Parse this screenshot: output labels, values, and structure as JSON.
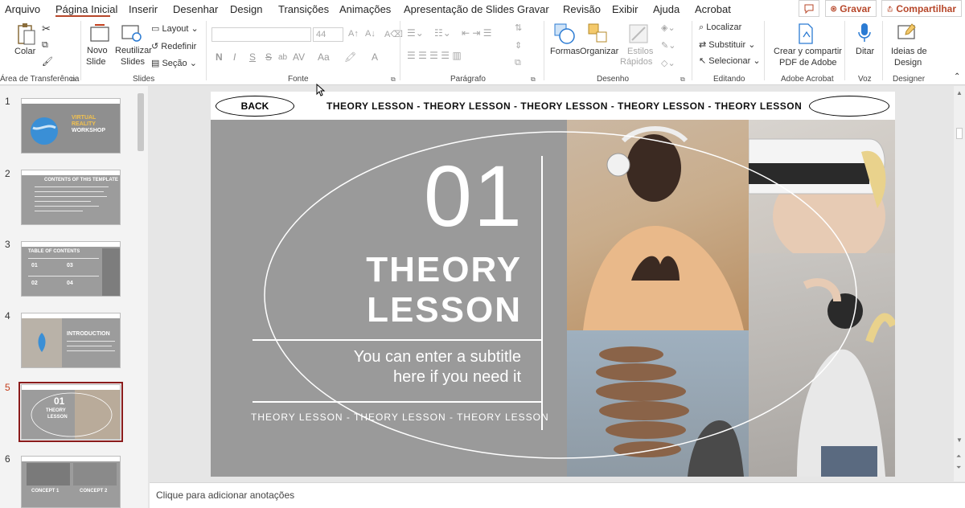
{
  "menu": {
    "tabs": [
      "Arquivo",
      "Página Inicial",
      "Inserir",
      "Desenhar",
      "Design",
      "Transições",
      "Animações",
      "Apresentação de Slides",
      "Gravar",
      "Revisão",
      "Exibir",
      "Ajuda",
      "Acrobat"
    ],
    "active_tab": "Página Inicial",
    "record_label": "Gravar",
    "share_label": "Compartilhar"
  },
  "ribbon": {
    "clipboard": {
      "paste": "Colar",
      "group": "Área de Transferência"
    },
    "slides": {
      "new_slide_1": "Novo",
      "new_slide_2": "Slide",
      "reuse_1": "Reutilizar",
      "reuse_2": "Slides",
      "layout": "Layout",
      "reset": "Redefinir",
      "section": "Seção",
      "group": "Slides"
    },
    "font": {
      "name_value": "",
      "size_value": "44",
      "bold": "N",
      "italic": "I",
      "underline": "S",
      "strike": "S",
      "spacing": "AV",
      "case": "Aa",
      "group": "Fonte"
    },
    "paragraph": {
      "group": "Parágrafo"
    },
    "drawing": {
      "shapes": "Formas",
      "arrange": "Organizar",
      "styles_1": "Estilos",
      "styles_2": "Rápidos",
      "group": "Desenho"
    },
    "editing": {
      "find": "Localizar",
      "replace": "Substituir",
      "select": "Selecionar",
      "group": "Editando"
    },
    "acrobat": {
      "create_1": "Crear y compartir",
      "create_2": "PDF de Adobe",
      "group": "Adobe Acrobat"
    },
    "voice": {
      "dictate": "Ditar",
      "group": "Voz"
    },
    "designer": {
      "ideas_1": "Ideias de",
      "ideas_2": "Design",
      "group": "Designer"
    }
  },
  "thumbnails": {
    "numbers": [
      "1",
      "2",
      "3",
      "4",
      "5",
      "6"
    ],
    "active_index": 5,
    "t1": [
      "VIRTUAL",
      "REALITY",
      "WORKSHOP"
    ],
    "t2": "CONTENTS OF THIS TEMPLATE",
    "t3": "TABLE OF CONTENTS",
    "t4": "INTRODUCTION",
    "t5": [
      "01",
      "THEORY",
      "LESSON"
    ],
    "t6": [
      "CONCEPT 1",
      "CONCEPT 2"
    ]
  },
  "slide": {
    "back_label": "BACK",
    "marquee": "THEORY LESSON - THEORY LESSON - THEORY LESSON - THEORY LESSON - THEORY LESSON",
    "number": "01",
    "title_line1": "THEORY",
    "title_line2": "LESSON",
    "subtitle_line1": "You can enter a subtitle",
    "subtitle_line2": "here if you need it",
    "bottom_marquee": "THEORY LESSON - THEORY LESSON - THEORY LESSON"
  },
  "notes": {
    "placeholder": "Clique para adicionar anotações"
  },
  "colors": {
    "accent": "#b7472a",
    "slide_gray": "#9a9a9a",
    "active_thumb": "#8b1b1b"
  }
}
